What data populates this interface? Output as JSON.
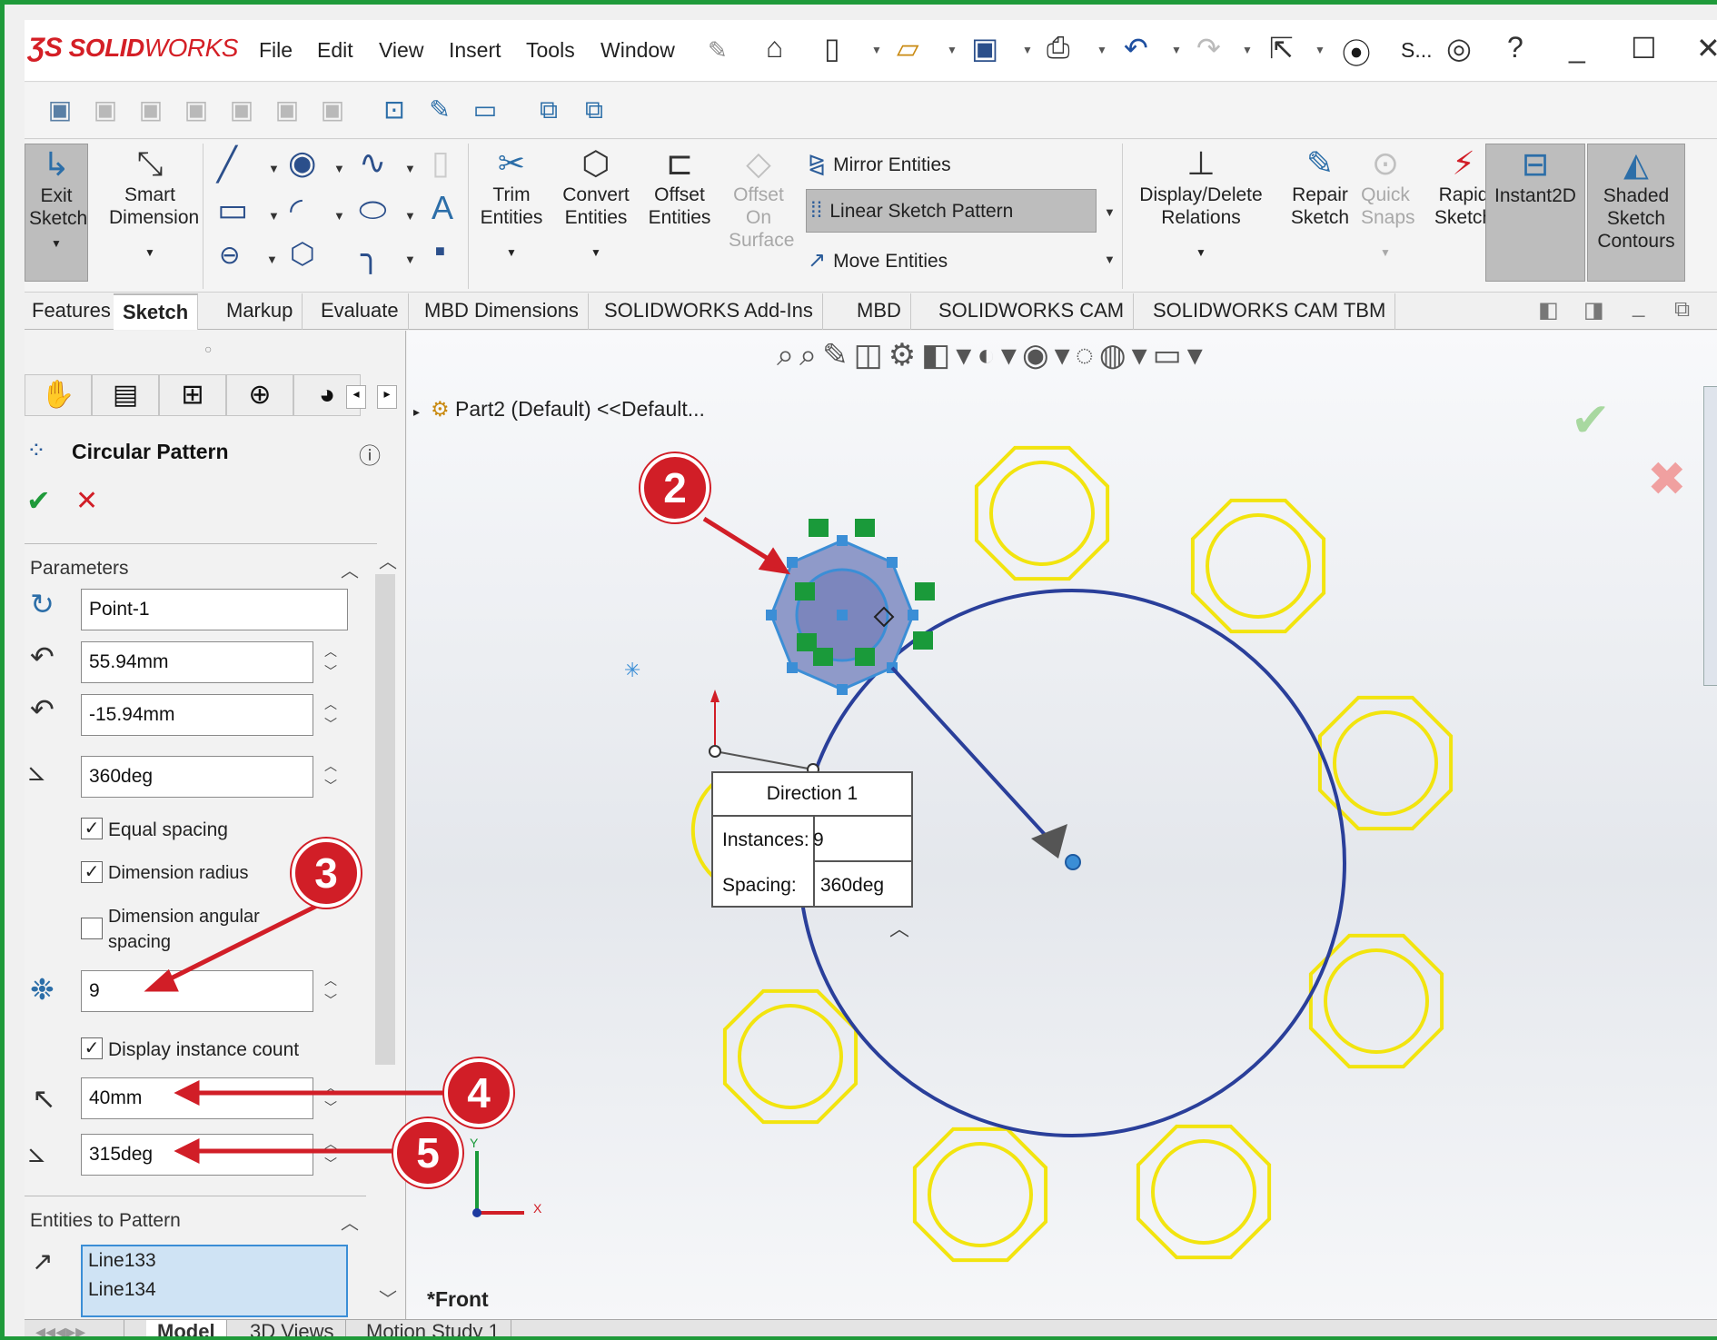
{
  "app": {
    "logo_ds": "ƷS",
    "logo_solid": "SOLID",
    "logo_works": "WORKS",
    "search_abbrev": "S..."
  },
  "menu": [
    "File",
    "Edit",
    "View",
    "Insert",
    "Tools",
    "Window"
  ],
  "commands": {
    "exit_sketch": "Exit Sketch",
    "smart_dimension": "Smart Dimension",
    "trim_entities": "Trim Entities",
    "convert_entities": "Convert Entities",
    "offset_entities": "Offset Entities",
    "offset_on_surface": "Offset On Surface",
    "mirror_entities": "Mirror Entities",
    "linear_sketch_pattern": "Linear Sketch Pattern",
    "move_entities": "Move Entities",
    "display_delete_relations": "Display/Delete Relations",
    "repair_sketch": "Repair Sketch",
    "quick_snaps": "Quick Snaps",
    "rapid_sketch": "Rapid Sketch",
    "instant2d": "Instant2D",
    "shaded_sketch_contours": "Shaded Sketch Contours"
  },
  "tabs": [
    "Features",
    "Sketch",
    "Markup",
    "Evaluate",
    "MBD Dimensions",
    "SOLIDWORKS Add-Ins",
    "MBD",
    "SOLIDWORKS CAM",
    "SOLIDWORKS CAM TBM"
  ],
  "active_tab": "Sketch",
  "tree": {
    "part": "Part2 (Default) <<Default..."
  },
  "panel": {
    "title": "Circular Pattern",
    "parameters_header": "Parameters",
    "center_point": "Point-1",
    "center_x": "55.94mm",
    "center_y": "-15.94mm",
    "angle": "360deg",
    "equal_spacing": "Equal spacing",
    "equal_spacing_checked": true,
    "dimension_radius": "Dimension radius",
    "dimension_radius_checked": true,
    "dimension_angular_spacing_1": "Dimension angular",
    "dimension_angular_spacing_2": "spacing",
    "dimension_angular_checked": false,
    "instances": "9",
    "display_instance_count": "Display instance count",
    "display_instance_count_checked": true,
    "radius": "40mm",
    "arc_angle": "315deg",
    "entities_header": "Entities to Pattern",
    "entities": [
      "Line133",
      "Line134"
    ]
  },
  "direction_box": {
    "title": "Direction 1",
    "instances_label": "Instances:",
    "instances_value": "9",
    "spacing_label": "Spacing:",
    "spacing_value": "360deg"
  },
  "view": {
    "orientation": "*Front",
    "axis_x": "X",
    "axis_y": "Y"
  },
  "callouts": [
    "2",
    "3",
    "4",
    "5"
  ],
  "bottom_tabs": [
    "Model",
    "3D Views",
    "Motion Study 1"
  ],
  "colors": {
    "accent_red": "#d11e27",
    "frame_green": "#1f9a3a",
    "sketch_blue": "#2a3f9a",
    "pattern_yellow": "#f2e40f"
  }
}
